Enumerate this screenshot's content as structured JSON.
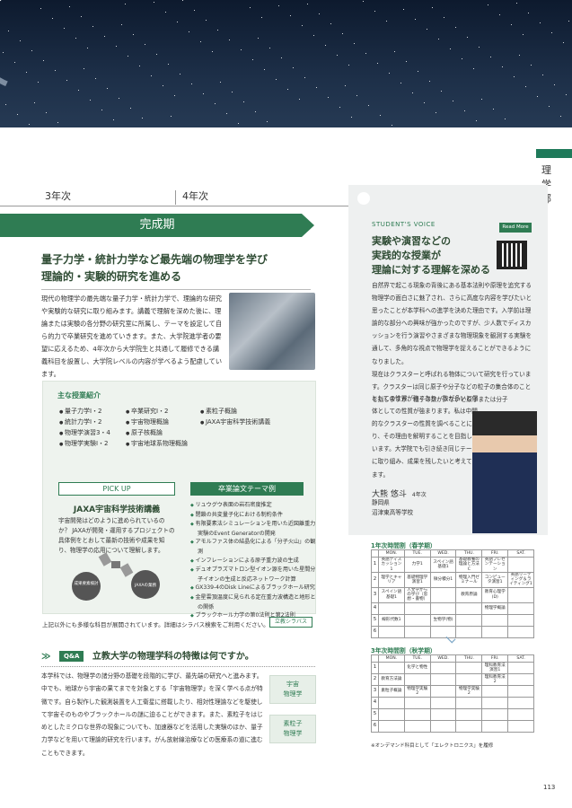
{
  "side_label": "理学部",
  "timeline": {
    "year3": "3年次",
    "year4": "4年次"
  },
  "banner": "完成期",
  "headline": [
    "量子力学・統計力学など最先端の物理学を学び",
    "理論的・実験的研究を進める"
  ],
  "lead": "現代の物理学の最先端な量子力学・統計力学で、理論的な研究や実験的な研究に取り組みます。講義で理解を深めた後に、理論または実験の各分野の研究室に所属し、テーマを設定して自ら的力で卒業研究を進めていきます。また、大学院進学者の要望に応えるため、4年次から大学院生と共通して履修できる講義科目を設置し、大学院レベルの内容が学べるよう配慮しています。",
  "courses": {
    "heading": "主な授業紹介",
    "col1": [
      "量子力学Ⅰ・2",
      "統計力学Ⅰ・2",
      "物理学演習3・4",
      "物理学実験Ⅰ・2"
    ],
    "col2": [
      "卒業研究Ⅰ・2",
      "宇宙物理概論",
      "原子核概論",
      "宇宙地球系物理概論"
    ],
    "col3": [
      "素粒子概論",
      "JAXA宇宙科学技術講義"
    ]
  },
  "pickup": {
    "label": "PICK UP",
    "title": "JAXA宇宙科学技術講義",
    "body": "宇宙開発はどのように進められているのか？ JAXAが開発・運用するプロジェクトの具体例をとおして最新の技術や成果を知り、物理学の応用について理解します。",
    "illus_labels": [
      "成果要素検討",
      "JAXAの業務"
    ]
  },
  "thesis": {
    "label": "卒業論文テーマ例",
    "items": [
      "リュウグウ表面の岩石密度推定",
      "閉鎖の共変量子化における制約条件",
      "有限要素法シミュレーションを用いた近図離重力実験のEvent Generatorの開発",
      "アモルファス体の結晶化による「分子火山」の観測",
      "インフレーションによる原子重力波の生成",
      "デュオプラズマトロン型イオン源を用いた星間分子イオンの生成と反応ネットワーク計算",
      "GX339-4のDisk Lineによるブラックホール研究",
      "金星雲頂温度に見られる定在重力波構造と地形との関係",
      "ブラックホール力学の第0法則と第2法則"
    ]
  },
  "note": "上記以外にも多様な科目が展開されています。詳細はシラバス検索をご利用ください。",
  "syllabus_btn": "立教シラバス",
  "qa": {
    "tag": "Q&A",
    "question": "立教大学の物理学科の特徴は何ですか。",
    "answer": "本学科では、物理学の諸分野の基礎を段階的に学び、最先端の研究へと進みます。中でも、地球から宇宙の果てまでを対象とする「宇宙物理学」を深く学べる点が特徴です。自ら製作した観測装置を人工衛星に搭載したり、相対性理論などを駆使して宇宙そのものやブラックホールの謎に迫ることができます。また、素粒子をはじめとしたミクロな世界の現象についても、加速器などを活用した実験のほか、量子力学などを用いて理論的研究を行います。がん放射線治療などの医療系の道に進むこともできます。",
    "badges": [
      [
        "宇宙",
        "物理学"
      ],
      [
        "素粒子",
        "物理学"
      ]
    ]
  },
  "voice": {
    "label": "STUDENT'S VOICE",
    "read_more": "Read More",
    "title": [
      "実験や演習などの",
      "実践的な授業が",
      "理論に対する理解を深める"
    ],
    "body1": "自然界で起こる現象の背後にある基本法則や原理を追究する物理学の面白さに魅了され、さらに高度な内容を学びたいと思ったことが本学科への進学を決めた理由です。入学前は理論的な部分への興味が強かったのですが、少人数でディスカッションを行う演習やさまざまな物理現象を観測する実験を通して、多角的な視点で物理学を捉えることができるようになりました。",
    "body2a": "現在はクラスターと呼ばれる物体について研究を行っています。クラスターは同じ原子や分子などの粒子の集合体のことを指しますが、粒子の数が少ないと原子または分子",
    "body2b": "としての性質が強くなり、数が多いと個体としての性質が強まります。私は中間的なクラスターの性質を調べることにより、その理由を解明することを目指しています。大学院でも引き続き同じテーマに取り組み、成果を残したいと考えています。",
    "name": "大熊 悠斗",
    "year": "4年次",
    "pref": "静岡県",
    "school": "沼津東高等学校"
  },
  "tt_spring": {
    "title": "1年次時間割（春学期）",
    "days": [
      "MON.",
      "TUE.",
      "WED.",
      "THU.",
      "FRI.",
      "SAT."
    ],
    "rows": [
      [
        "1",
        "英語ディスカッション1",
        "力学1",
        "スペイン語基礎1",
        "基礎教養の理論と方法C",
        "英語プレゼンテーション",
        ""
      ],
      [
        "2",
        "理学とキャリア",
        "基礎物理学演習1",
        "微分積分1",
        "物理入門ゼミナール",
        "コンピュータ演習1",
        "英語リーディング＆ライティング1"
      ],
      [
        "3",
        "スペイン語基礎1",
        "人文学からの学び（思想・書物）",
        "",
        "教育原論",
        "教育心理学(D)",
        ""
      ],
      [
        "4",
        "",
        "",
        "",
        "",
        "物理学概論",
        ""
      ],
      [
        "5",
        "線形代数1",
        "",
        "生物学(物)",
        "",
        "",
        ""
      ],
      [
        "6",
        "",
        "",
        "",
        "",
        "",
        ""
      ]
    ]
  },
  "tt_fall": {
    "title": "3年次時間割（秋学期）",
    "days": [
      "MON.",
      "TUE.",
      "WED.",
      "THU.",
      "FRI.",
      "SAT."
    ],
    "rows": [
      [
        "1",
        "",
        "化学と物性",
        "",
        "",
        "理科教育法演習1",
        ""
      ],
      [
        "2",
        "教育方法論",
        "",
        "",
        "",
        "理科教育法2",
        ""
      ],
      [
        "3",
        "素粒子概論",
        "物理学実験2",
        "",
        "物理学実験2",
        "",
        ""
      ],
      [
        "4",
        "",
        "",
        "",
        "",
        "",
        ""
      ],
      [
        "5",
        "",
        "",
        "",
        "",
        "",
        ""
      ],
      [
        "6",
        "",
        "",
        "",
        "",
        "",
        ""
      ]
    ]
  },
  "tt_note": "※オンデマンド科目として「エレクトロニクス」を履修",
  "page_number": "113"
}
